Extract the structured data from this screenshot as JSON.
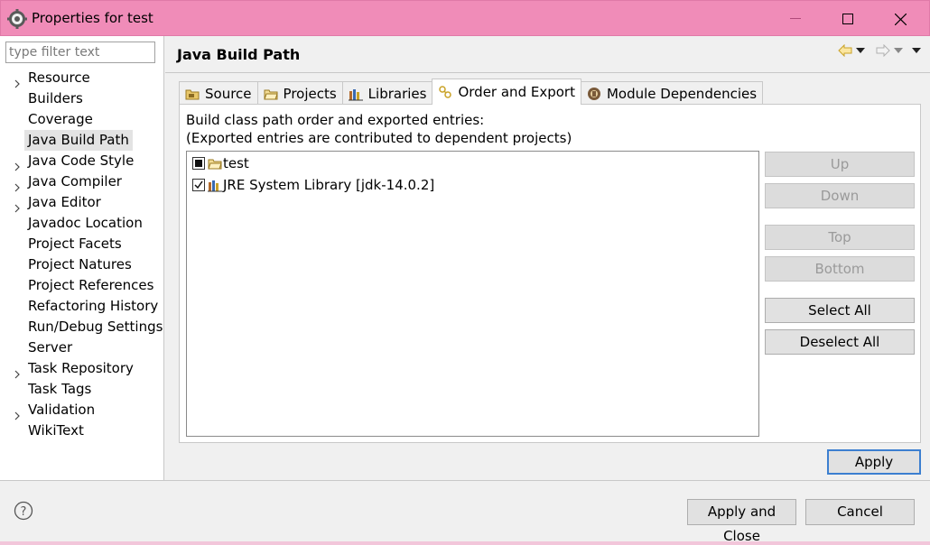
{
  "window": {
    "title": "Properties for test",
    "controls": [
      "minimize",
      "maximize",
      "close"
    ]
  },
  "sidebar": {
    "filter_placeholder": "type filter text",
    "items": [
      {
        "label": "Resource",
        "expandable": true
      },
      {
        "label": "Builders",
        "expandable": false
      },
      {
        "label": "Coverage",
        "expandable": false
      },
      {
        "label": "Java Build Path",
        "expandable": false,
        "selected": true
      },
      {
        "label": "Java Code Style",
        "expandable": true
      },
      {
        "label": "Java Compiler",
        "expandable": true
      },
      {
        "label": "Java Editor",
        "expandable": true
      },
      {
        "label": "Javadoc Location",
        "expandable": false
      },
      {
        "label": "Project Facets",
        "expandable": false
      },
      {
        "label": "Project Natures",
        "expandable": false
      },
      {
        "label": "Project References",
        "expandable": false
      },
      {
        "label": "Refactoring History",
        "expandable": false
      },
      {
        "label": "Run/Debug Settings",
        "expandable": false
      },
      {
        "label": "Server",
        "expandable": false
      },
      {
        "label": "Task Repository",
        "expandable": true
      },
      {
        "label": "Task Tags",
        "expandable": false
      },
      {
        "label": "Validation",
        "expandable": true
      },
      {
        "label": "WikiText",
        "expandable": false
      }
    ]
  },
  "page": {
    "title": "Java Build Path",
    "tabs": [
      {
        "label": "Source",
        "icon": "source-folder-icon"
      },
      {
        "label": "Projects",
        "icon": "project-folder-icon"
      },
      {
        "label": "Libraries",
        "icon": "library-icon"
      },
      {
        "label": "Order and Export",
        "icon": "order-export-icon",
        "active": true
      },
      {
        "label": "Module Dependencies",
        "icon": "module-icon"
      }
    ],
    "description_line1": "Build class path order and exported entries:",
    "description_line2": "(Exported entries are contributed to dependent projects)",
    "entries": [
      {
        "label": "test",
        "checked": "partial",
        "icon": "project-folder-icon"
      },
      {
        "label": "JRE System Library [jdk-14.0.2]",
        "checked": true,
        "icon": "library-icon"
      }
    ],
    "buttons": {
      "up": "Up",
      "down": "Down",
      "top": "Top",
      "bottom": "Bottom",
      "select_all": "Select All",
      "deselect_all": "Deselect All"
    },
    "apply": "Apply"
  },
  "footer": {
    "apply_and_close": "Apply and Close",
    "cancel": "Cancel"
  },
  "colors": {
    "titlebar": "#f08cb8",
    "focus_border": "#3c7fd0"
  }
}
